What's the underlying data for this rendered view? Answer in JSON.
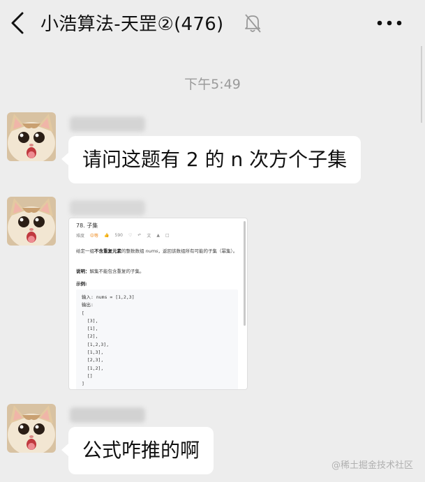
{
  "header": {
    "title": "小浩算法-天罡②(476)",
    "back_icon": "chevron-left-icon",
    "mute_icon": "bell-off-icon",
    "more_icon": "ellipsis-icon"
  },
  "timestamp": "下午5:49",
  "messages": [
    {
      "type": "text",
      "text": "请问这题有 2 的 n 次方个子集"
    },
    {
      "type": "image",
      "problem": {
        "title": "78. 子集",
        "meta": {
          "label": "难度",
          "difficulty": "中等",
          "likes": "590"
        },
        "description_pre": "给定一组",
        "description_bold": "不含重复元素",
        "description_mid": "的整数数组 ",
        "description_var": "nums",
        "description_post": "，返回该数组所有可能的子集（幂集）。",
        "note_bold": "说明：",
        "note_text": "解集不能包含重复的子集。",
        "example_label": "示例:",
        "code": "输入: nums = [1,2,3]\n输出:\n[\n  [3],\n  [1],\n  [2],\n  [1,2,3],\n  [1,3],\n  [2,3],\n  [1,2],\n  []\n]"
      }
    },
    {
      "type": "text",
      "text": "公式咋推的啊"
    }
  ],
  "watermark": "@稀土掘金技术社区",
  "colors": {
    "background": "#ededed",
    "bubble": "#ffffff",
    "timestamp": "#9a9a9a",
    "difficulty": "#ef8a1e"
  }
}
